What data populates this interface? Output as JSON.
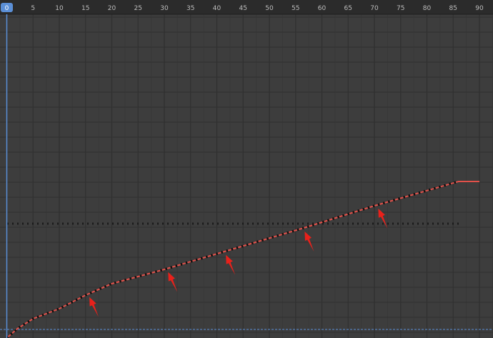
{
  "timeline": {
    "current_frame": "0",
    "frame_ticks": [
      "5",
      "10",
      "15",
      "20",
      "25",
      "30",
      "35",
      "40",
      "45",
      "50",
      "55",
      "60",
      "65",
      "70",
      "75",
      "80",
      "85",
      "90"
    ]
  },
  "colors": {
    "background": "#3d3d3d",
    "ruler": "#2b2b2b",
    "grid_major": "#303030",
    "grid_minor": "#373737",
    "playhead": "#5b8fd6",
    "curve": "#e2514a",
    "keyframe": "#111111",
    "annotation_arrow": "#e8211b",
    "reference_line": "#1a1a1a"
  },
  "curve": {
    "keyframes": [
      [
        0,
        473
      ],
      [
        2,
        460
      ],
      [
        5,
        446
      ],
      [
        10,
        432
      ],
      [
        15,
        413
      ],
      [
        20,
        397
      ],
      [
        30,
        377
      ],
      [
        41,
        353
      ],
      [
        57,
        318
      ],
      [
        70,
        288
      ],
      [
        86,
        254
      ],
      [
        90,
        254
      ]
    ]
  },
  "annotations": {
    "arrows": [
      {
        "frame": 16,
        "label": "arrow-1"
      },
      {
        "frame": 31,
        "label": "arrow-2"
      },
      {
        "frame": 42,
        "label": "arrow-3"
      },
      {
        "frame": 57,
        "label": "arrow-4"
      },
      {
        "frame": 71,
        "label": "arrow-5"
      }
    ]
  }
}
